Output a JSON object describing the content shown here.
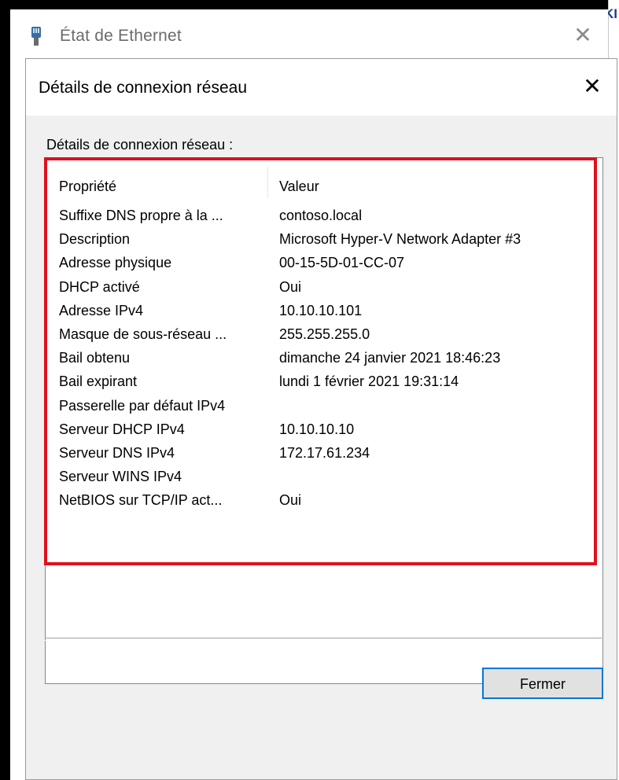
{
  "parent_window": {
    "title": "État de Ethernet",
    "close_glyph": "✕",
    "icon": "ethernet-plug-icon"
  },
  "background_window": {
    "edge_text": "KI"
  },
  "dialog": {
    "title": "Détails de connexion réseau",
    "close_glyph": "✕",
    "group_label": "Détails de connexion réseau :",
    "columns": {
      "property": "Propriété",
      "value": "Valeur"
    },
    "rows": [
      {
        "property": "Suffixe DNS propre à la ...",
        "value": "contoso.local"
      },
      {
        "property": "Description",
        "value": "Microsoft Hyper-V Network Adapter #3"
      },
      {
        "property": "Adresse physique",
        "value": "00-15-5D-01-CC-07"
      },
      {
        "property": "DHCP activé",
        "value": "Oui"
      },
      {
        "property": "Adresse IPv4",
        "value": "10.10.10.101"
      },
      {
        "property": "Masque de sous-réseau ...",
        "value": "255.255.255.0"
      },
      {
        "property": "Bail obtenu",
        "value": "dimanche 24 janvier 2021 18:46:23"
      },
      {
        "property": "Bail expirant",
        "value": "lundi 1 février 2021 19:31:14"
      },
      {
        "property": "Passerelle par défaut IPv4",
        "value": ""
      },
      {
        "property": "Serveur DHCP IPv4",
        "value": "10.10.10.10"
      },
      {
        "property": "Serveur DNS IPv4",
        "value": "172.17.61.234"
      },
      {
        "property": "Serveur WINS IPv4",
        "value": ""
      },
      {
        "property": "NetBIOS sur TCP/IP act...",
        "value": "Oui"
      }
    ],
    "close_button_label": "Fermer"
  },
  "colors": {
    "highlight": "#e0101e",
    "button_focus": "#0078d7",
    "dialog_bg": "#f0f0f0"
  }
}
